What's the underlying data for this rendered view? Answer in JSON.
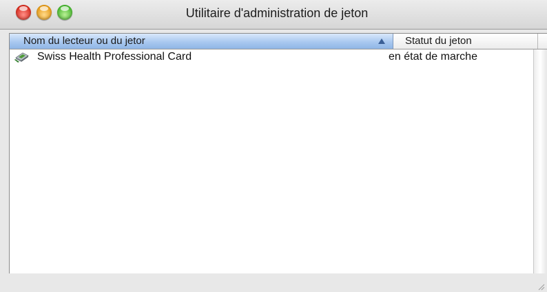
{
  "window": {
    "title": "Utilitaire d'administration de jeton"
  },
  "table": {
    "columns": [
      {
        "label": "Nom du lecteur ou du jetor",
        "sorted": true,
        "sort_direction": "ascending"
      },
      {
        "label": "Statut du jeton",
        "sorted": false
      }
    ],
    "rows": [
      {
        "icon": "smart-card-reader-icon",
        "name": "Swiss Health Professional Card",
        "status": "en état de marche"
      }
    ]
  },
  "colors": {
    "sorted_header": "#a9c8f0",
    "close": "#d62a1d",
    "minimize": "#e59a16",
    "zoom": "#45b62d"
  }
}
